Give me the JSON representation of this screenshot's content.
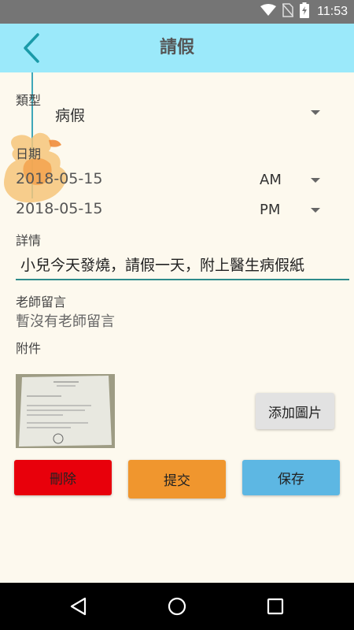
{
  "status": {
    "time": "11:53"
  },
  "header": {
    "title": "請假"
  },
  "form": {
    "type_label": "類型",
    "type_value": "病假",
    "date_label": "日期",
    "start_date": "2018-05-15",
    "start_period": "AM",
    "end_date": "2018-05-15",
    "end_period": "PM",
    "detail_label": "詳情",
    "detail_value": "小兒今天發燒，請假一天，附上醫生病假紙",
    "teacher_label": "老師留言",
    "teacher_value": "暫沒有老師留言",
    "attachment_label": "附件",
    "add_image_label": "添加圖片"
  },
  "actions": {
    "delete_label": "刪除",
    "submit_label": "提交",
    "save_label": "保存"
  },
  "colors": {
    "appbar": "#9BE9FA",
    "delete": "#E8000B",
    "submit": "#F0962E",
    "save": "#5DB7E3",
    "accent": "#2E8B8B"
  },
  "icons": [
    "wifi-icon",
    "no-sim-icon",
    "battery-icon",
    "back-icon",
    "dropdown-arrow-icon",
    "nav-back-icon",
    "nav-home-icon",
    "nav-recents-icon"
  ]
}
